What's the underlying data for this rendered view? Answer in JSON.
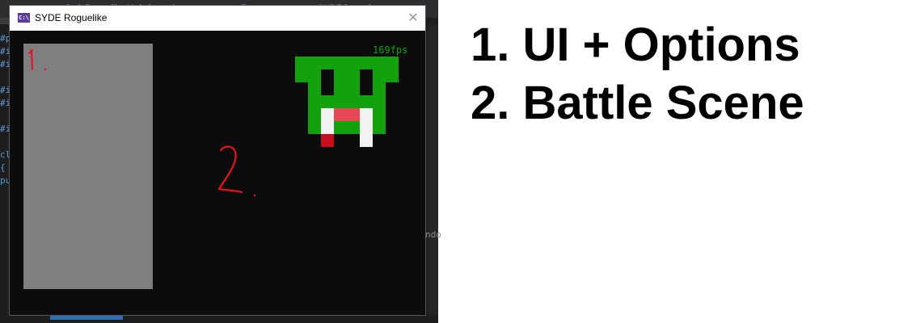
{
  "ide": {
    "tabs": [
      "SydeRoguelike.MainControl",
      "Form.cpp",
      "SYDEGameCon"
    ],
    "gutter": [
      "#p",
      "#i",
      "#i",
      "",
      "#i",
      "#i",
      "",
      "#i",
      "",
      "cl",
      "{",
      "pu"
    ],
    "side_text": "ndo"
  },
  "window": {
    "title": "SYDE Roguelike",
    "icon_text": "C:\\",
    "close_symbol": "✕",
    "fps": "169fps"
  },
  "colors": {
    "window_bg": "#0c0c0c",
    "ui_panel": "#7f7f7f",
    "monster_green": "#13a10e",
    "monster_eye": "#0c0c0c",
    "monster_mouth": "#e74856",
    "monster_fang": "#f2f2f2",
    "monster_blood": "#c50f1f",
    "annotation_red": "#e81123"
  },
  "annotations": {
    "panel_marker": "1.",
    "scene_marker": "2."
  },
  "notes": {
    "line1": "1. UI + Options",
    "line2": "2. Battle Scene"
  }
}
